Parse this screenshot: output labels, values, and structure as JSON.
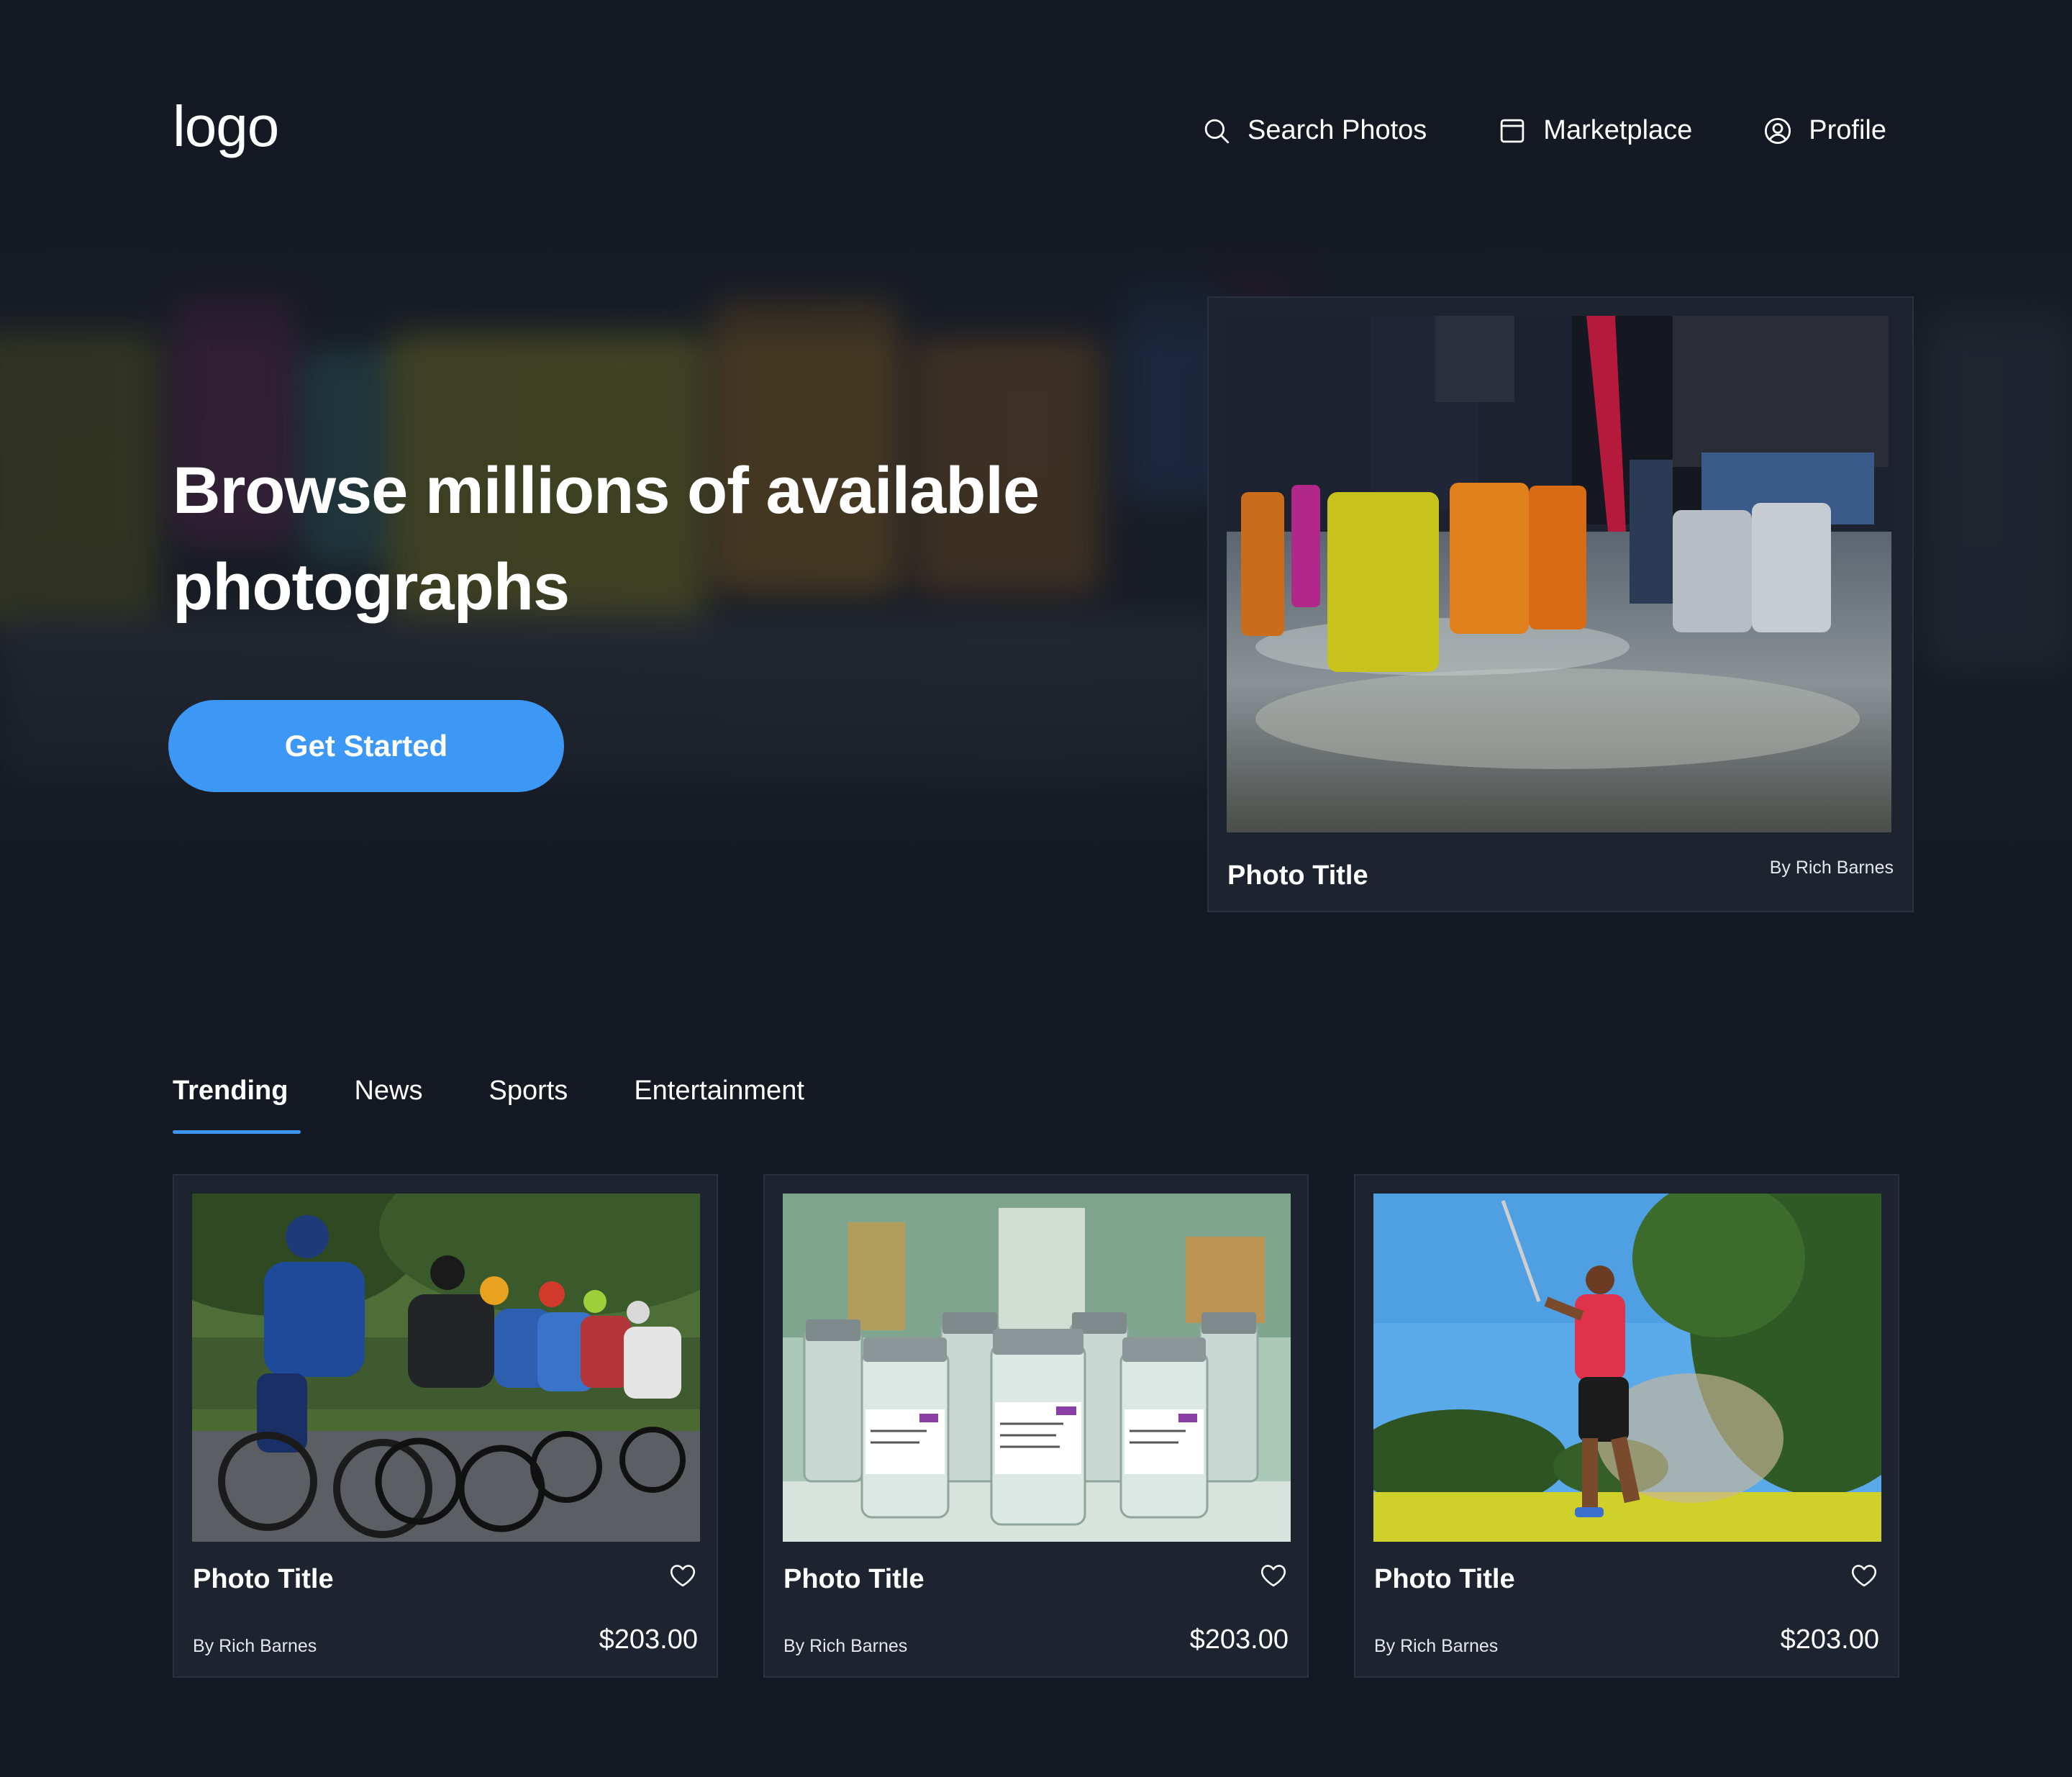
{
  "header": {
    "logo": "logo",
    "nav": [
      {
        "label": "Search Photos",
        "icon": "search-icon"
      },
      {
        "label": "Marketplace",
        "icon": "marketplace-icon"
      },
      {
        "label": "Profile",
        "icon": "profile-icon"
      }
    ]
  },
  "hero": {
    "headline": "Browse millions of available photographs",
    "cta_label": "Get Started",
    "featured": {
      "title": "Photo Title",
      "author": "By Rich Barnes"
    }
  },
  "tabs": [
    {
      "label": "Trending",
      "active": true
    },
    {
      "label": "News",
      "active": false
    },
    {
      "label": "Sports",
      "active": false
    },
    {
      "label": "Entertainment",
      "active": false
    }
  ],
  "cards": [
    {
      "title": "Photo Title",
      "author": "By Rich Barnes",
      "price": "$203.00"
    },
    {
      "title": "Photo Title",
      "author": "By Rich Barnes",
      "price": "$203.00"
    },
    {
      "title": "Photo Title",
      "author": "By Rich Barnes",
      "price": "$203.00"
    }
  ],
  "colors": {
    "background": "#151923",
    "card": "#1e2330",
    "accent": "#3d97f5"
  }
}
